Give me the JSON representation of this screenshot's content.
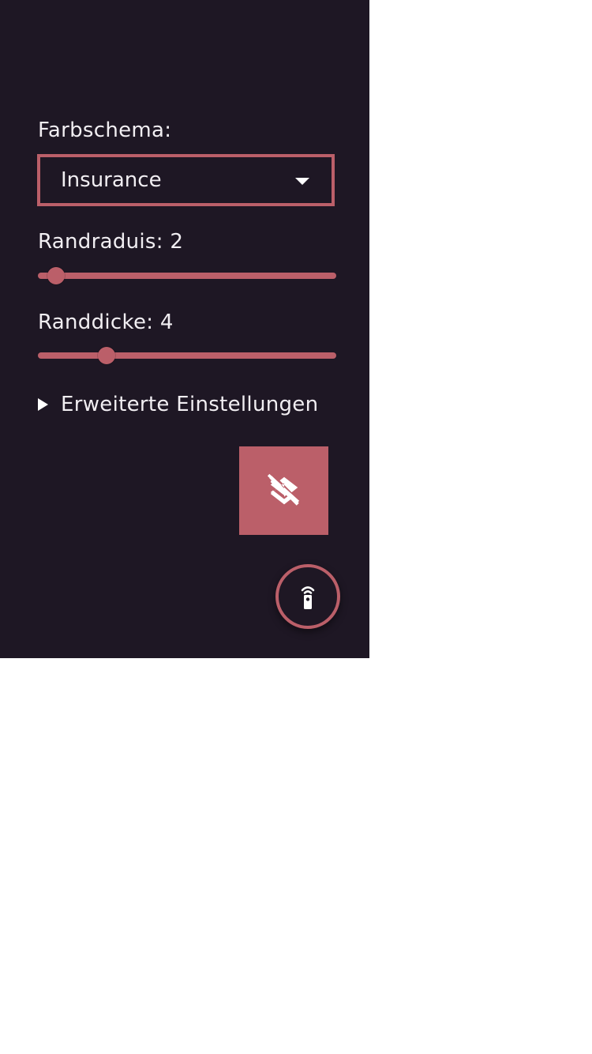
{
  "settings": {
    "color_scheme_label": "Farbschema:",
    "color_scheme_value": "Insurance",
    "border_radius_label": "Randraduis: 2",
    "border_radius_value": 2,
    "border_radius_fraction": 0.06,
    "border_width_label": "Randdicke: 4",
    "border_width_value": 4,
    "border_width_fraction": 0.23,
    "advanced_label": "Erweiterte Einstellungen"
  },
  "icons": {
    "select_caret": "caret-down-icon",
    "details_toggle": "triangle-right-icon",
    "layers_button": "layers-off-icon",
    "remote_button": "remote-control-icon"
  },
  "colors": {
    "panel_background": "#1e1724",
    "accent": "#bb5f69",
    "text": "#f1eef2",
    "page_background": "#ffffff"
  }
}
